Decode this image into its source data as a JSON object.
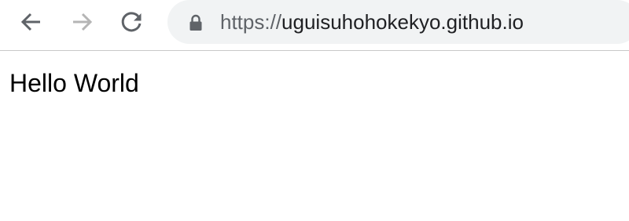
{
  "browser": {
    "address_bar": {
      "scheme": "https://",
      "host": "uguisuhohokekyo.github.io"
    },
    "icons": {
      "back": "back-arrow-icon",
      "forward": "forward-arrow-icon",
      "reload": "reload-icon",
      "lock": "lock-icon"
    },
    "forward_enabled": false
  },
  "page": {
    "body_text": "Hello World"
  },
  "colors": {
    "toolbar_bg": "#ffffff",
    "omnibox_bg": "#f1f3f4",
    "icon_active": "#5f6368",
    "icon_disabled": "#b5b5b5",
    "divider": "#c8c8c8"
  }
}
